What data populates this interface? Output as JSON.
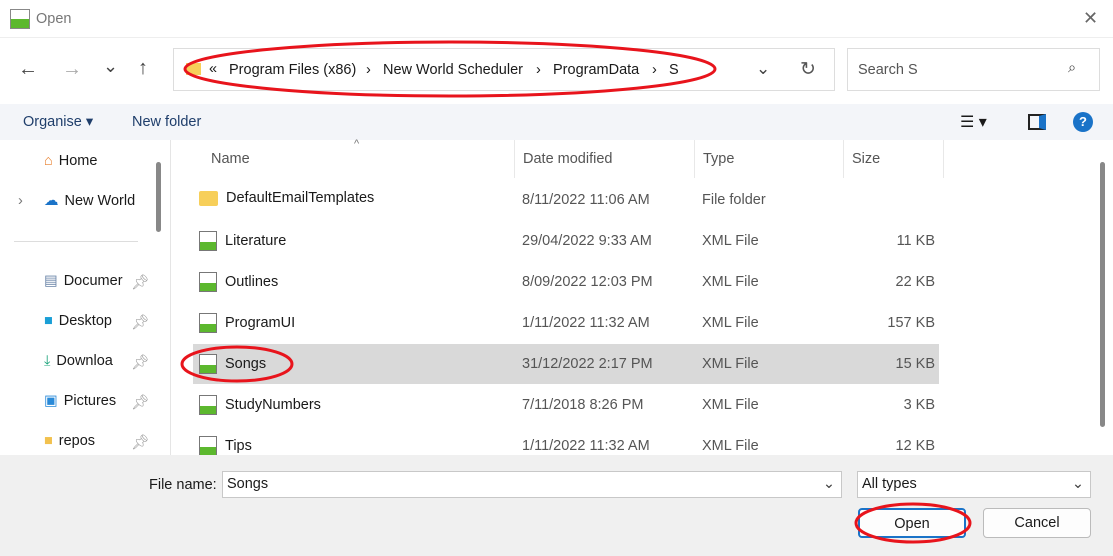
{
  "window": {
    "title": "Open"
  },
  "nav": {
    "back": "←",
    "forward": "→",
    "recent": "⌄",
    "up": "↑",
    "refresh": "↻"
  },
  "address": {
    "overflow": "«",
    "crumbs": [
      "Program Files (x86)",
      "New World Scheduler",
      "ProgramData",
      "S"
    ],
    "sep": "›"
  },
  "search": {
    "placeholder": "Search S"
  },
  "toolbar": {
    "organise": "Organise ▾",
    "new_folder": "New folder",
    "help": "?"
  },
  "sidebar": {
    "items": [
      {
        "label": "Home",
        "icon": "home-icon"
      },
      {
        "label": "New World",
        "icon": "cloud-icon"
      },
      {
        "label": "Documer",
        "icon": "documents-icon"
      },
      {
        "label": "Desktop",
        "icon": "desktop-icon"
      },
      {
        "label": "Downloa",
        "icon": "download-icon"
      },
      {
        "label": "Pictures",
        "icon": "pictures-icon"
      },
      {
        "label": "repos",
        "icon": "folder-icon"
      }
    ]
  },
  "columns": [
    "Name",
    "Date modified",
    "Type",
    "Size"
  ],
  "files": [
    {
      "name": "DefaultEmailTemplates",
      "date": "8/11/2022 11:06 AM",
      "type": "File folder",
      "size": "",
      "icon": "folder"
    },
    {
      "name": "Literature",
      "date": "29/04/2022 9:33 AM",
      "type": "XML File",
      "size": "11 KB",
      "icon": "xml"
    },
    {
      "name": "Outlines",
      "date": "8/09/2022 12:03 PM",
      "type": "XML File",
      "size": "22 KB",
      "icon": "xml"
    },
    {
      "name": "ProgramUI",
      "date": "1/11/2022 11:32 AM",
      "type": "XML File",
      "size": "157 KB",
      "icon": "xml"
    },
    {
      "name": "Songs",
      "date": "31/12/2022 2:17 PM",
      "type": "XML File",
      "size": "15 KB",
      "icon": "xml",
      "selected": true
    },
    {
      "name": "StudyNumbers",
      "date": "7/11/2018 8:26 PM",
      "type": "XML File",
      "size": "3 KB",
      "icon": "xml"
    },
    {
      "name": "Tips",
      "date": "1/11/2022 11:32 AM",
      "type": "XML File",
      "size": "12 KB",
      "icon": "xml"
    }
  ],
  "bottom": {
    "file_name_label": "File name:",
    "file_name": "Songs",
    "filter": "All types",
    "open": "Open",
    "cancel": "Cancel"
  },
  "annotation_color": "#e8141c"
}
